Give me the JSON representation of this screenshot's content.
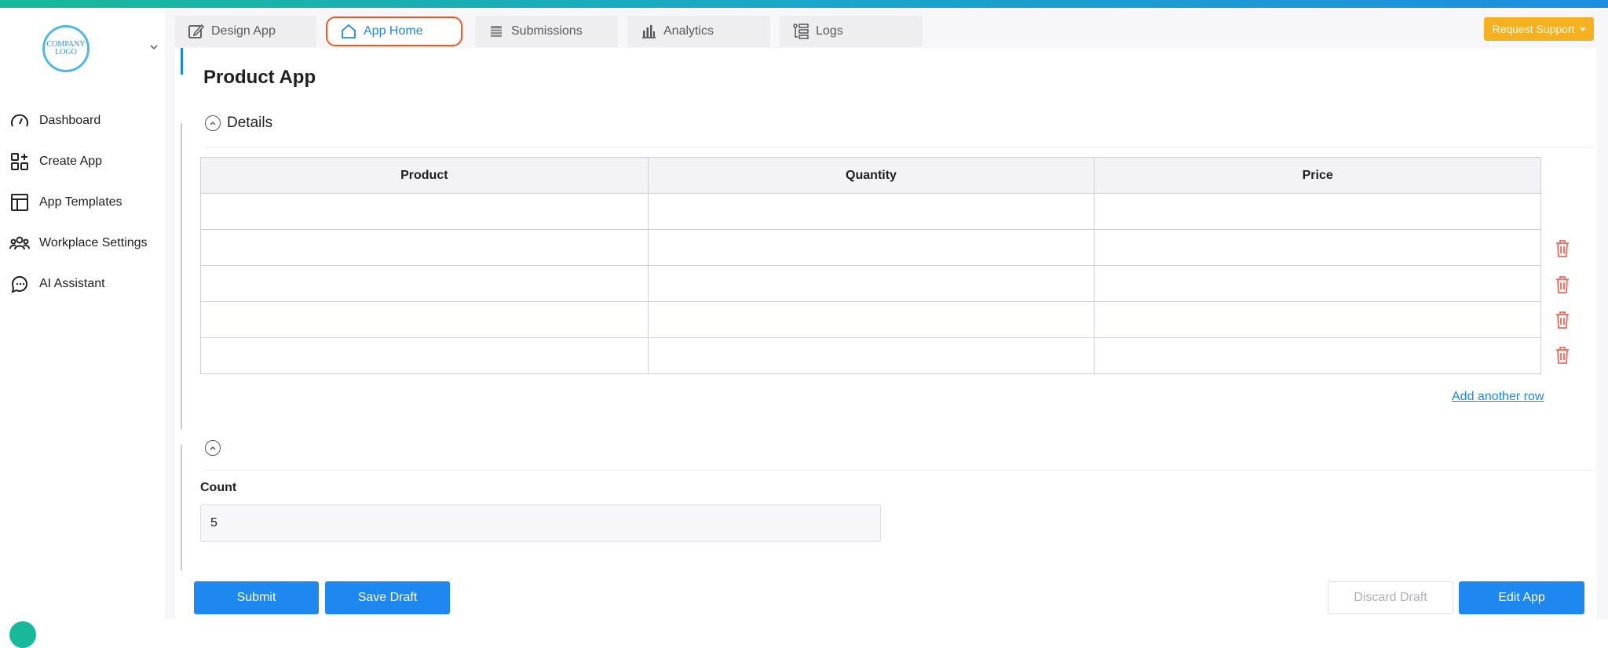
{
  "logo": {
    "text_line1": "COMPANY",
    "text_line2": "LOGO"
  },
  "sidebar": {
    "items": [
      {
        "label": "Dashboard",
        "icon": "gauge-icon"
      },
      {
        "label": "Create App",
        "icon": "create-app-icon"
      },
      {
        "label": "App Templates",
        "icon": "templates-icon"
      },
      {
        "label": "Workplace Settings",
        "icon": "team-icon"
      },
      {
        "label": "AI Assistant",
        "icon": "chat-bot-icon"
      }
    ]
  },
  "tabs": [
    {
      "label": "Design App",
      "icon": "edit-icon",
      "active": false
    },
    {
      "label": "App Home",
      "icon": "home-icon",
      "active": true
    },
    {
      "label": "Submissions",
      "icon": "table-icon",
      "active": false
    },
    {
      "label": "Analytics",
      "icon": "bar-chart-icon",
      "active": false
    },
    {
      "label": "Logs",
      "icon": "logs-icon",
      "active": false
    }
  ],
  "support_button": {
    "label": "Request Support"
  },
  "page": {
    "title": "Product App"
  },
  "details_section": {
    "title": "Details",
    "columns": [
      "Product",
      "Quantity",
      "Price"
    ],
    "rows": [
      [
        "",
        "",
        ""
      ],
      [
        "",
        "",
        ""
      ],
      [
        "",
        "",
        ""
      ],
      [
        "",
        "",
        ""
      ],
      [
        "",
        "",
        ""
      ]
    ],
    "add_row_label": "Add another row"
  },
  "count_section": {
    "label": "Count",
    "value": "5"
  },
  "actions": {
    "submit": "Submit",
    "save_draft": "Save Draft",
    "discard_draft": "Discard Draft",
    "edit_app": "Edit App"
  },
  "colors": {
    "accent": "#1e88e5",
    "active_tab_border": "#f05a22",
    "support_button": "#f6b120",
    "delete_icon": "#f26a5a"
  }
}
